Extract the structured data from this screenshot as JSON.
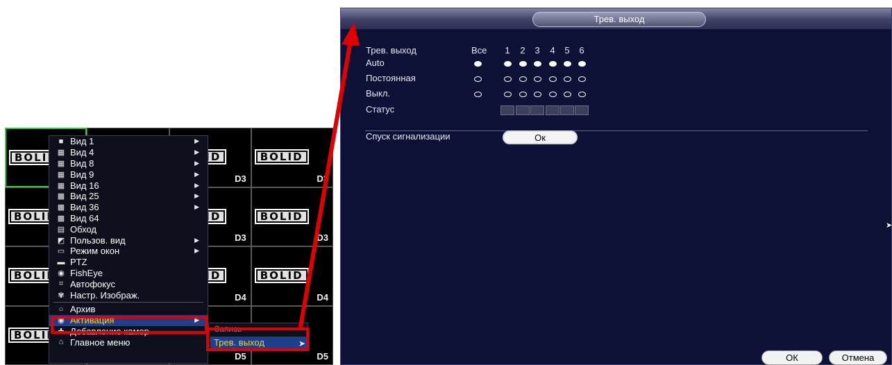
{
  "grid": {
    "logo_text": "BOLID",
    "cells": [
      {
        "label": "",
        "selected": true
      },
      {
        "label": "D3"
      },
      {
        "label": "D3"
      },
      {
        "label": "D3"
      },
      {
        "label": ""
      },
      {
        "label": "D3"
      },
      {
        "label": "D3"
      },
      {
        "label": "D3"
      },
      {
        "label": ""
      },
      {
        "label": "D4"
      },
      {
        "label": "D4"
      },
      {
        "label": "D4"
      },
      {
        "label": "D5"
      },
      {
        "label": "D5"
      },
      {
        "label": "D5"
      },
      {
        "label": "D5"
      }
    ]
  },
  "context_menu": {
    "items": [
      {
        "label": "Вид 1",
        "icon": "view-1-icon",
        "glyph": "■",
        "submenu": true
      },
      {
        "label": "Вид 4",
        "icon": "view-4-icon",
        "glyph": "▦",
        "submenu": true
      },
      {
        "label": "Вид 8",
        "icon": "view-8-icon",
        "glyph": "▦",
        "submenu": true
      },
      {
        "label": "Вид 9",
        "icon": "view-9-icon",
        "glyph": "▦",
        "submenu": true
      },
      {
        "label": "Вид 16",
        "icon": "view-16-icon",
        "glyph": "▦",
        "submenu": true
      },
      {
        "label": "Вид 25",
        "icon": "view-25-icon",
        "glyph": "▩",
        "submenu": true
      },
      {
        "label": "Вид 36",
        "icon": "view-36-icon",
        "glyph": "▩",
        "submenu": true
      },
      {
        "label": "Вид 64",
        "icon": "view-64-icon",
        "glyph": "▩",
        "submenu": false
      },
      {
        "label": "Обход",
        "icon": "tour-icon",
        "glyph": "▤",
        "submenu": false
      },
      {
        "label": "Пользов. вид",
        "icon": "custom-view-icon",
        "glyph": "◩",
        "submenu": true
      },
      {
        "label": "Режим окон",
        "icon": "window-mode-icon",
        "glyph": "▭",
        "submenu": true
      },
      {
        "label": "PTZ",
        "icon": "ptz-icon",
        "glyph": "▬",
        "submenu": false
      },
      {
        "label": "FishEye",
        "icon": "fisheye-icon",
        "glyph": "◉",
        "submenu": false
      },
      {
        "label": "Автофокус",
        "icon": "autofocus-icon",
        "glyph": "⌗",
        "submenu": false
      },
      {
        "label": "Настр. Изображ.",
        "icon": "image-settings-icon",
        "glyph": "✾",
        "submenu": false,
        "sep_after": true
      },
      {
        "label": "Архив",
        "icon": "archive-search-icon",
        "glyph": "○",
        "submenu": false
      },
      {
        "label": "Активация",
        "icon": "activation-icon",
        "glyph": "◉",
        "submenu": true,
        "active": true
      },
      {
        "label": "Добавление камер",
        "icon": "add-camera-icon",
        "glyph": "✚",
        "submenu": false
      },
      {
        "label": "Главное меню",
        "icon": "home-icon",
        "glyph": "⌂",
        "submenu": false
      }
    ]
  },
  "submenu": {
    "item_partial": "Запись",
    "item_selected": "Трев. выход"
  },
  "dialog": {
    "title": "Трев. выход",
    "header_label": "Трев. выход",
    "all_label": "Все",
    "channels": [
      "1",
      "2",
      "3",
      "4",
      "5",
      "6"
    ],
    "rows": [
      {
        "label": "Auto",
        "all": true,
        "values": [
          true,
          true,
          true,
          true,
          true,
          true
        ]
      },
      {
        "label": "Постоянная",
        "all": false,
        "values": [
          false,
          false,
          false,
          false,
          false,
          false
        ]
      },
      {
        "label": "Выкл.",
        "all": false,
        "values": [
          false,
          false,
          false,
          false,
          false,
          false
        ]
      }
    ],
    "status_label": "Статус",
    "alarm_release_label": "Спуск сигнализации",
    "alarm_release_button": "Ок",
    "ok_button": "ОК",
    "cancel_button": "Отмена"
  },
  "colors": {
    "highlight_red": "#e00000",
    "menu_active_text": "#ffd400",
    "menu_active_bg": "#1c3f8e",
    "dialog_bg": "#0d1136"
  }
}
